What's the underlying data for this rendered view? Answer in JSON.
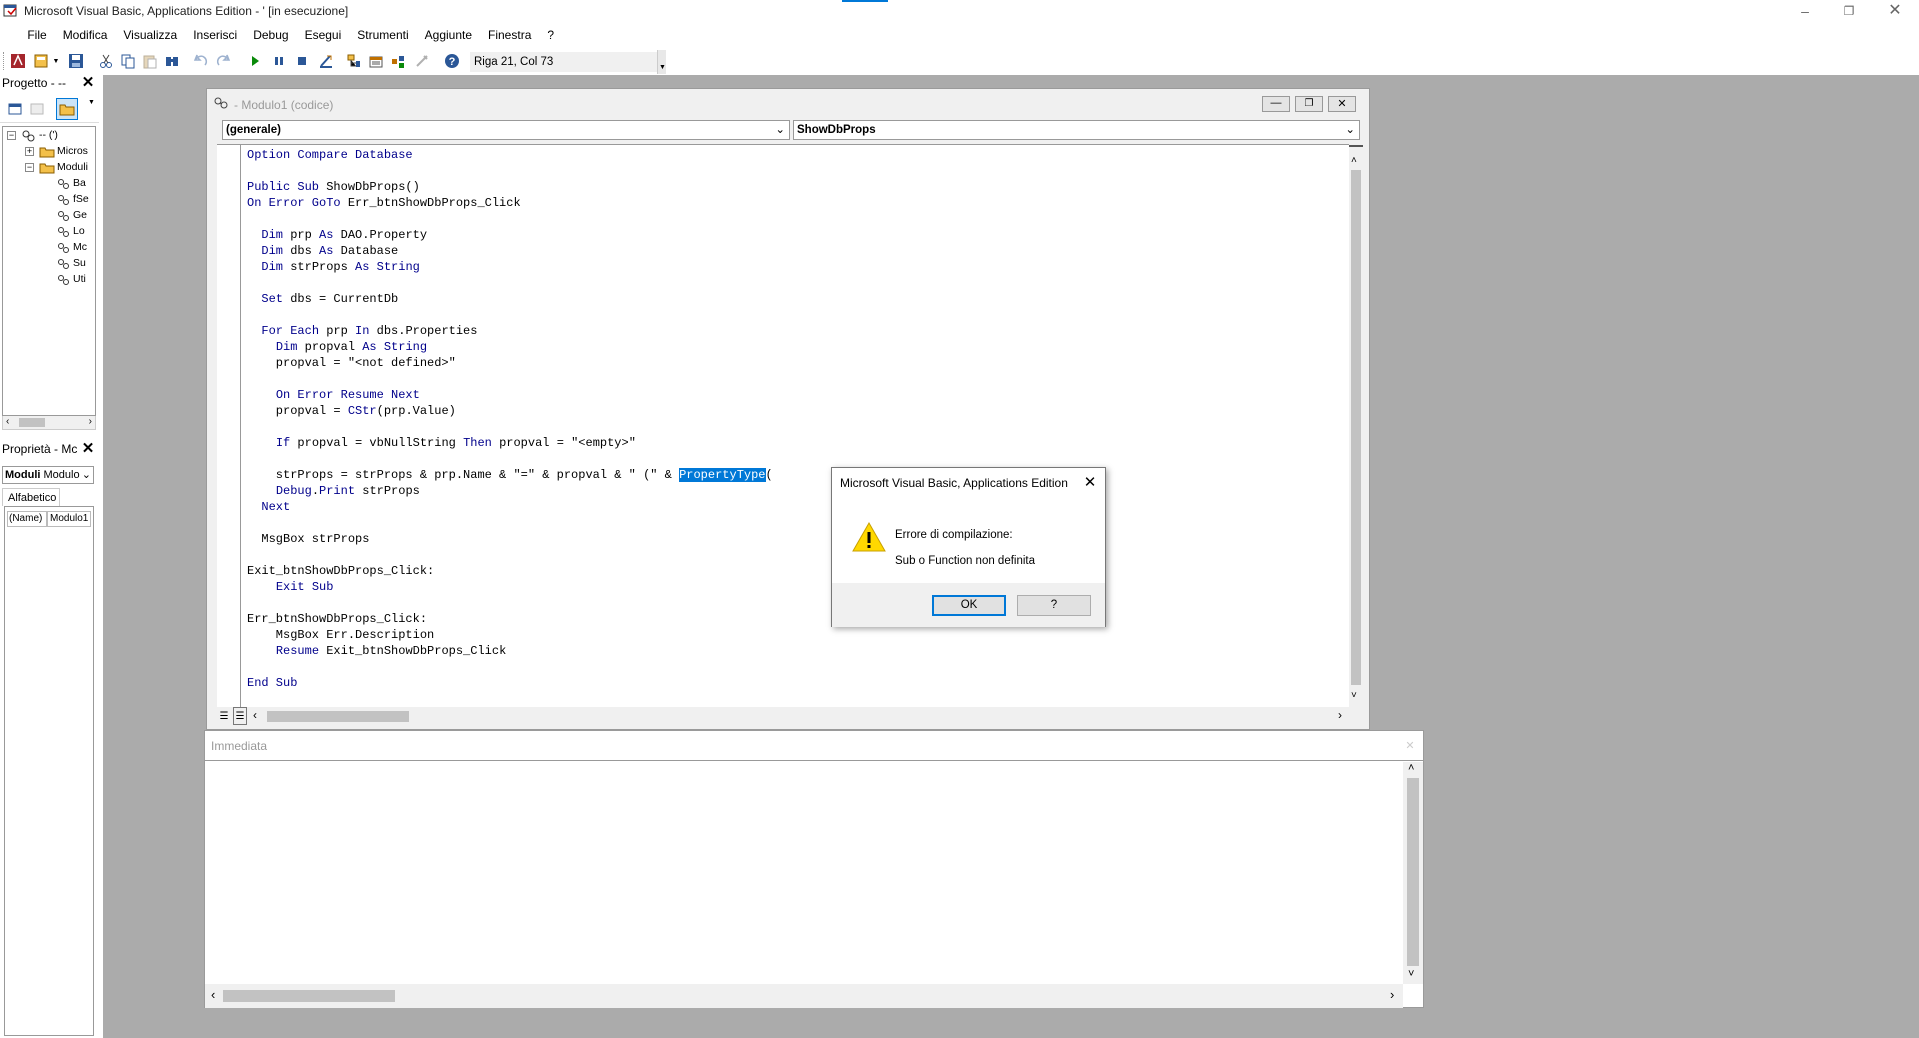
{
  "window": {
    "title": "Microsoft Visual Basic, Applications Edition - ' [in esecuzione]"
  },
  "menu": [
    {
      "label": "File",
      "u": "F",
      "rest": "ile"
    },
    {
      "label": "Modifica",
      "u": "M",
      "rest": "odifica"
    },
    {
      "label": "Visualizza",
      "u": "V",
      "rest": "isualizza"
    },
    {
      "label": "Inserisci",
      "u": "I",
      "rest": "nserisci"
    },
    {
      "label": "Debug",
      "u": "D",
      "rest": "ebug"
    },
    {
      "label": "Esegui",
      "u": "E",
      "rest": "segui"
    },
    {
      "label": "Strumenti",
      "u": "S",
      "rest": "trumenti"
    },
    {
      "label": "Aggiunte",
      "u": "A",
      "rest": "ggiunte"
    },
    {
      "label": "Finestra",
      "u": "n",
      "pre": "Fi",
      "rest": "estra"
    },
    {
      "label": "?",
      "u": "?",
      "rest": ""
    }
  ],
  "toolbar": {
    "position": "Riga 21, Col 73"
  },
  "project": {
    "title": "Progetto - --",
    "root": "-- (')",
    "folders": [
      "Micros",
      "Moduli"
    ],
    "modules": [
      "Ba",
      "fSe",
      "Ge",
      "Lo",
      "Mc",
      "Su",
      "Uti"
    ]
  },
  "properties": {
    "title": "Proprietà - Mc",
    "object": "Moduli",
    "object_type": "Modulo",
    "tab": "Alfabetico",
    "row_name": "(Name)",
    "row_value": "Modulo1"
  },
  "code_window": {
    "title": "- Modulo1 (codice)",
    "object_combo": "(generale)",
    "proc_combo": "ShowDbProps"
  },
  "immediate": {
    "title": "Immediata"
  },
  "dialog": {
    "title": "Microsoft Visual Basic, Applications Edition",
    "line1": "Errore di compilazione:",
    "line2": "Sub o Function non definita",
    "ok": "OK",
    "help": "?"
  },
  "colors": {
    "keyword": "#00008b",
    "selection": "#0078d7",
    "mdi_bg": "#ababab"
  }
}
